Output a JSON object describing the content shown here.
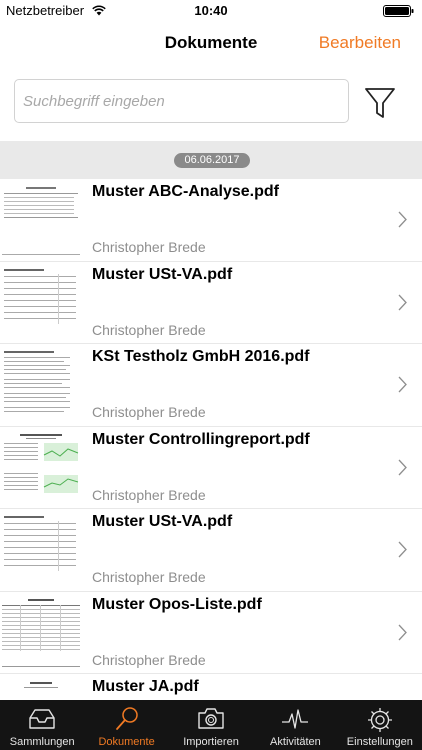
{
  "status_bar": {
    "carrier": "Netzbetreiber",
    "time": "10:40"
  },
  "nav": {
    "title": "Dokumente",
    "edit_label": "Bearbeiten"
  },
  "search": {
    "placeholder": "Suchbegriff eingeben",
    "value": ""
  },
  "filter_icon": "filter-icon",
  "date_group": "06.06.2017",
  "documents": [
    {
      "title": "Muster ABC-Analyse.pdf",
      "author": "Christopher Brede"
    },
    {
      "title": "Muster USt-VA.pdf",
      "author": "Christopher Brede"
    },
    {
      "title": "KSt Testholz GmbH 2016.pdf",
      "author": "Christopher Brede"
    },
    {
      "title": "Muster Controllingreport.pdf",
      "author": "Christopher Brede"
    },
    {
      "title": "Muster USt-VA.pdf",
      "author": "Christopher Brede"
    },
    {
      "title": "Muster Opos-Liste.pdf",
      "author": "Christopher Brede"
    },
    {
      "title": "Muster JA.pdf",
      "author": ""
    }
  ],
  "tabs": [
    {
      "label": "Sammlungen",
      "icon": "tray-icon",
      "active": false
    },
    {
      "label": "Dokumente",
      "icon": "search-icon",
      "active": true
    },
    {
      "label": "Importieren",
      "icon": "camera-icon",
      "active": false
    },
    {
      "label": "Aktivitäten",
      "icon": "activity-icon",
      "active": false
    },
    {
      "label": "Einstellungen",
      "icon": "gear-icon",
      "active": false
    }
  ],
  "colors": {
    "accent": "#f07a24",
    "tab_bar": "#141414",
    "date_section": "#e9e9e9",
    "author": "#8e8e8e"
  }
}
